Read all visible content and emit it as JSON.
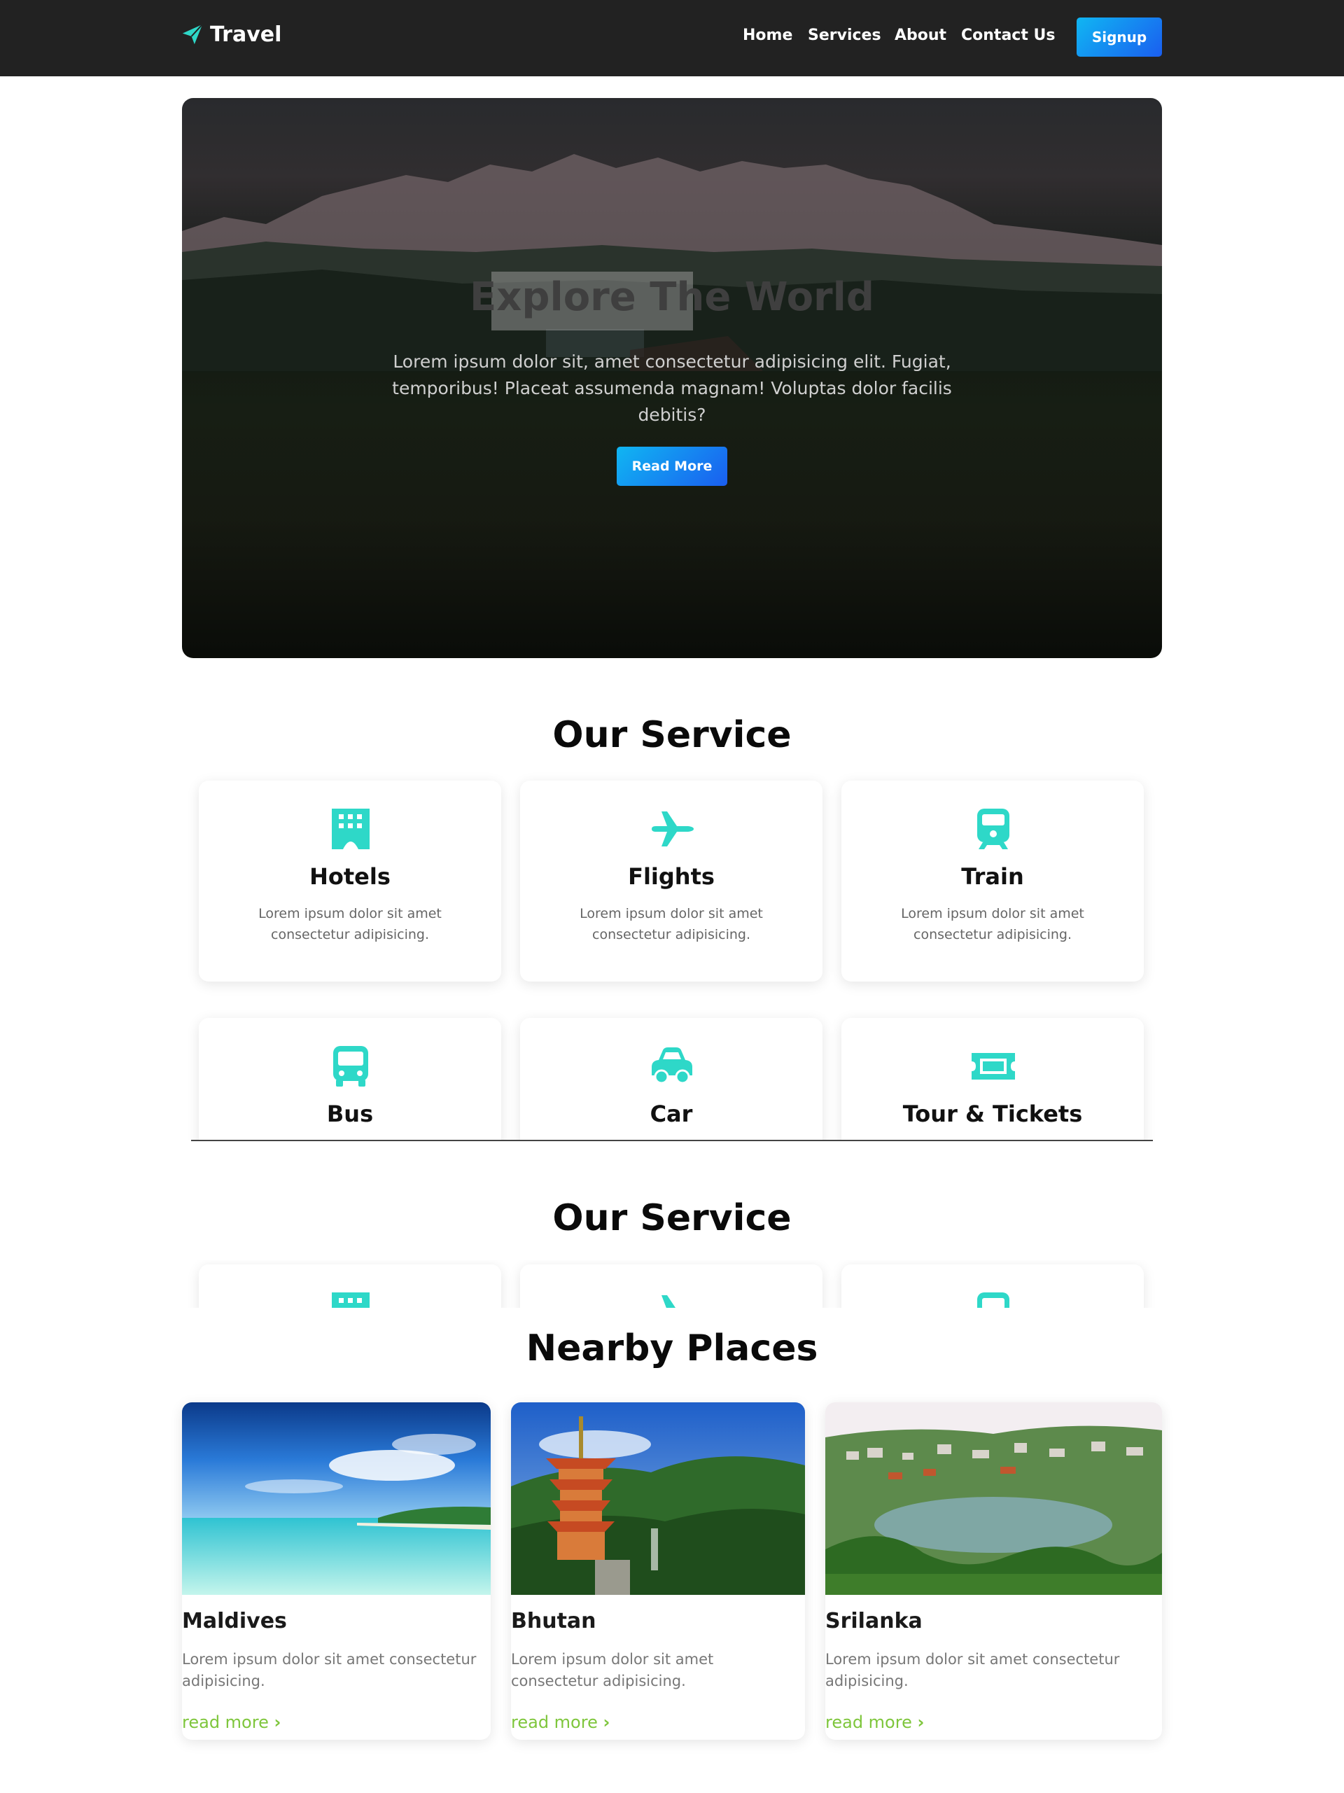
{
  "nav": {
    "brand": "Travel",
    "brand_icon": "paper-plane-icon",
    "links": [
      "Home",
      "Services",
      "About",
      "Contact Us"
    ],
    "signup": "Signup"
  },
  "hero": {
    "title": "Explore The World",
    "text": "Lorem ipsum dolor sit, amet consectetur adipisicing elit. Fugiat, temporibus! Placeat assumenda magnam! Voluptas dolor facilis debitis?",
    "button": "Read More"
  },
  "services": {
    "title": "Our Service",
    "items": [
      {
        "title": "Hotels",
        "icon": "hotel-icon",
        "desc": "Lorem ipsum dolor sit amet consectetur adipisicing."
      },
      {
        "title": "Flights",
        "icon": "plane-icon",
        "desc": "Lorem ipsum dolor sit amet consectetur adipisicing."
      },
      {
        "title": "Train",
        "icon": "train-icon",
        "desc": "Lorem ipsum dolor sit amet consectetur adipisicing."
      },
      {
        "title": "Bus",
        "icon": "bus-icon"
      },
      {
        "title": "Car",
        "icon": "car-icon"
      },
      {
        "title": "Tour & Tickets",
        "icon": "ticket-icon"
      }
    ]
  },
  "services_repeat": {
    "title": "Our Service"
  },
  "places": {
    "title": "Nearby Places",
    "items": [
      {
        "name": "Maldives",
        "desc": "Lorem ipsum dolor sit amet consectetur adipisicing.",
        "link": "read more"
      },
      {
        "name": "Bhutan",
        "desc": "Lorem ipsum dolor sit amet consectetur adipisicing.",
        "link": "read more"
      },
      {
        "name": "Srilanka",
        "desc": "Lorem ipsum dolor sit amet consectetur adipisicing.",
        "link": "read more"
      }
    ]
  },
  "colors": {
    "navbar": "#222222",
    "accent_gradient_start": "#10b6f2",
    "accent_gradient_end": "#1a5ef0",
    "icon": "#2ed8c8",
    "link_green": "#7ec63c"
  }
}
